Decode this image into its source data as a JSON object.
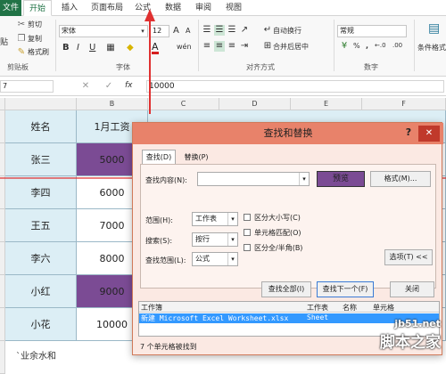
{
  "ribbon_tabs": [
    "文件",
    "开始",
    "插入",
    "页面布局",
    "公式",
    "数据",
    "审阅",
    "视图"
  ],
  "clipboard": {
    "cut": "剪切",
    "copy": "复制",
    "format_painter": "格式刷",
    "paste_fragment": "贴",
    "label": "剪贴板"
  },
  "font": {
    "name": "宋体",
    "size": "12",
    "label": "字体",
    "grow": "A",
    "shrink": "A",
    "bold": "B",
    "italic": "I",
    "underline": "U",
    "fill_symbol": "◆",
    "font_color": "A",
    "wen": "wén"
  },
  "alignment": {
    "wrap": "自动换行",
    "merge": "合并后居中",
    "label": "对齐方式"
  },
  "number": {
    "format": "常规",
    "percent": "%",
    "comma": ",",
    "label": "数字",
    "dec1": "←.0",
    "dec2": ".00"
  },
  "cond_format": "条件格式",
  "formula_bar": {
    "cell_ref": "7",
    "value": "10000",
    "fx": "fx"
  },
  "columns": [
    "B",
    "C",
    "D",
    "E",
    "F"
  ],
  "table": {
    "header_name": "姓名",
    "header_salary": "1月工资",
    "rows": [
      {
        "name": "张三",
        "salary": "5000",
        "highlight": true
      },
      {
        "name": "李四",
        "salary": "6000",
        "highlight": false
      },
      {
        "name": "王五",
        "salary": "7000",
        "highlight": false
      },
      {
        "name": "李六",
        "salary": "8000",
        "highlight": false
      },
      {
        "name": "小红",
        "salary": "9000",
        "highlight": true
      },
      {
        "name": "小花",
        "salary": "10000",
        "highlight": false
      }
    ],
    "footer": "`业余水和"
  },
  "dialog": {
    "title": "查找和替换",
    "help": "?",
    "close": "✕",
    "tab_find": "查找(D)",
    "tab_replace": "替换(P)",
    "find_label": "查找内容(N):",
    "preview": "预览",
    "format_button": "格式(M)...",
    "within_label": "范围(H):",
    "within_value": "工作表",
    "search_label": "搜索(S):",
    "search_value": "按行",
    "lookin_label": "查找范围(L):",
    "lookin_value": "公式",
    "match_case": "区分大小写(C)",
    "match_cell": "单元格匹配(O)",
    "match_width": "区分全/半角(B)",
    "options_button": "选项(T) <<",
    "find_all": "查找全部(I)",
    "find_next": "查找下一个(F)",
    "close_button": "关闭",
    "results_headers": [
      "工作簿",
      "工作表",
      "名称",
      "单元格"
    ],
    "result_workbook": "新建 Microsoft Excel Worksheet.xlsx",
    "result_sheet": "Sheet",
    "status": "7 个单元格被找到"
  },
  "watermark": {
    "site": "jb51.net",
    "brand": "脚本之家"
  },
  "colors": {
    "excel_green": "#217346",
    "highlight_purple": "#7b4b94",
    "dialog_title": "#e8826a",
    "annotation_red": "#e03030"
  }
}
